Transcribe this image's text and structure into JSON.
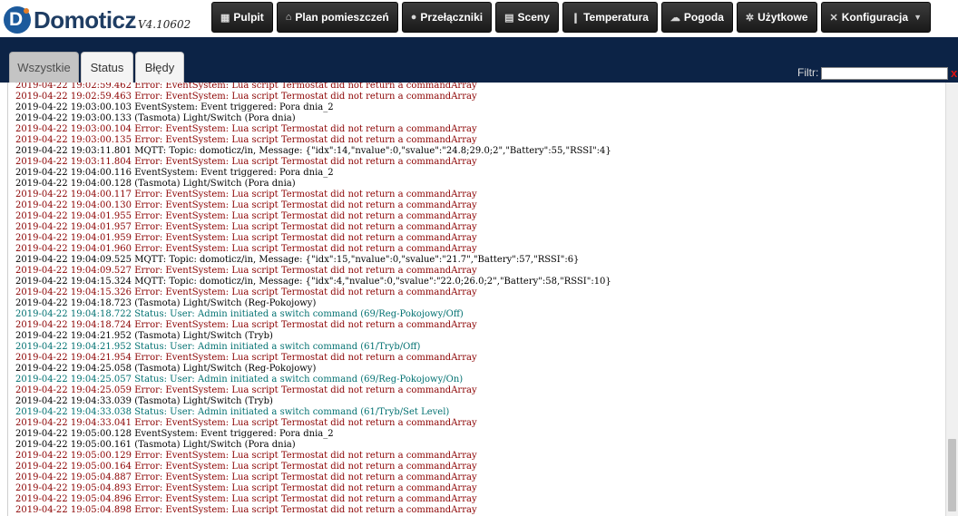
{
  "app": {
    "name": "Domoticz",
    "version": "V4.10602"
  },
  "nav": [
    {
      "label": "Pulpit",
      "icon": "dashboard-icon",
      "glyph": "▦",
      "caret": false
    },
    {
      "label": "Plan pomieszczeń",
      "icon": "floorplan-icon",
      "glyph": "⌂",
      "caret": false
    },
    {
      "label": "Przełączniki",
      "icon": "lightbulb-icon",
      "glyph": "●",
      "caret": false
    },
    {
      "label": "Sceny",
      "icon": "scenes-icon",
      "glyph": "▤",
      "caret": false
    },
    {
      "label": "Temperatura",
      "icon": "thermometer-icon",
      "glyph": "❙",
      "caret": false
    },
    {
      "label": "Pogoda",
      "icon": "weather-icon",
      "glyph": "☁",
      "caret": false
    },
    {
      "label": "Użytkowe",
      "icon": "utility-icon",
      "glyph": "✲",
      "caret": false
    },
    {
      "label": "Konfiguracja",
      "icon": "wrench-icon",
      "glyph": "✕",
      "caret": true
    }
  ],
  "tabs": [
    {
      "label": "Wszystkie",
      "active": true
    },
    {
      "label": "Status",
      "active": false
    },
    {
      "label": "Błędy",
      "active": false
    }
  ],
  "filter": {
    "label": "Filtr:",
    "value": "",
    "placeholder": "",
    "clear_glyph": "x"
  },
  "colors": {
    "topbar_bg": "#ffffff",
    "band_bg": "#0c2346",
    "error_text": "#8b0000",
    "status_text": "#007070",
    "normal_text": "#000000"
  },
  "log": [
    {
      "t": "2019-04-22 19:02:59.462",
      "type": "error",
      "msg": "Error: EventSystem: Lua script Termostat did not return a commandArray"
    },
    {
      "t": "2019-04-22 19:02:59.463",
      "type": "error",
      "msg": "Error: EventSystem: Lua script Termostat did not return a commandArray"
    },
    {
      "t": "2019-04-22 19:03:00.103",
      "type": "norm",
      "msg": "EventSystem: Event triggered: Pora dnia_2"
    },
    {
      "t": "2019-04-22 19:03:00.133",
      "type": "norm",
      "msg": "(Tasmota) Light/Switch (Pora dnia)"
    },
    {
      "t": "2019-04-22 19:03:00.104",
      "type": "error",
      "msg": "Error: EventSystem: Lua script Termostat did not return a commandArray"
    },
    {
      "t": "2019-04-22 19:03:00.135",
      "type": "error",
      "msg": "Error: EventSystem: Lua script Termostat did not return a commandArray"
    },
    {
      "t": "2019-04-22 19:03:11.801",
      "type": "norm",
      "msg": "MQTT: Topic: domoticz/in, Message: {\"idx\":14,\"nvalue\":0,\"svalue\":\"24.8;29.0;2\",\"Battery\":55,\"RSSI\":4}"
    },
    {
      "t": "2019-04-22 19:03:11.804",
      "type": "error",
      "msg": "Error: EventSystem: Lua script Termostat did not return a commandArray"
    },
    {
      "t": "2019-04-22 19:04:00.116",
      "type": "norm",
      "msg": "EventSystem: Event triggered: Pora dnia_2"
    },
    {
      "t": "2019-04-22 19:04:00.128",
      "type": "norm",
      "msg": "(Tasmota) Light/Switch (Pora dnia)"
    },
    {
      "t": "2019-04-22 19:04:00.117",
      "type": "error",
      "msg": "Error: EventSystem: Lua script Termostat did not return a commandArray"
    },
    {
      "t": "2019-04-22 19:04:00.130",
      "type": "error",
      "msg": "Error: EventSystem: Lua script Termostat did not return a commandArray"
    },
    {
      "t": "2019-04-22 19:04:01.955",
      "type": "error",
      "msg": "Error: EventSystem: Lua script Termostat did not return a commandArray"
    },
    {
      "t": "2019-04-22 19:04:01.957",
      "type": "error",
      "msg": "Error: EventSystem: Lua script Termostat did not return a commandArray"
    },
    {
      "t": "2019-04-22 19:04:01.959",
      "type": "error",
      "msg": "Error: EventSystem: Lua script Termostat did not return a commandArray"
    },
    {
      "t": "2019-04-22 19:04:01.960",
      "type": "error",
      "msg": "Error: EventSystem: Lua script Termostat did not return a commandArray"
    },
    {
      "t": "2019-04-22 19:04:09.525",
      "type": "norm",
      "msg": "MQTT: Topic: domoticz/in, Message: {\"idx\":15,\"nvalue\":0,\"svalue\":\"21.7\",\"Battery\":57,\"RSSI\":6}"
    },
    {
      "t": "2019-04-22 19:04:09.527",
      "type": "error",
      "msg": "Error: EventSystem: Lua script Termostat did not return a commandArray"
    },
    {
      "t": "2019-04-22 19:04:15.324",
      "type": "norm",
      "msg": "MQTT: Topic: domoticz/in, Message: {\"idx\":4,\"nvalue\":0,\"svalue\":\"22.0;26.0;2\",\"Battery\":58,\"RSSI\":10}"
    },
    {
      "t": "2019-04-22 19:04:15.326",
      "type": "error",
      "msg": "Error: EventSystem: Lua script Termostat did not return a commandArray"
    },
    {
      "t": "2019-04-22 19:04:18.723",
      "type": "norm",
      "msg": "(Tasmota) Light/Switch (Reg-Pokojowy)"
    },
    {
      "t": "2019-04-22 19:04:18.722",
      "type": "status",
      "msg": "Status: User: Admin initiated a switch command (69/Reg-Pokojowy/Off)"
    },
    {
      "t": "2019-04-22 19:04:18.724",
      "type": "error",
      "msg": "Error: EventSystem: Lua script Termostat did not return a commandArray"
    },
    {
      "t": "2019-04-22 19:04:21.952",
      "type": "norm",
      "msg": "(Tasmota) Light/Switch (Tryb)"
    },
    {
      "t": "2019-04-22 19:04:21.952",
      "type": "status",
      "msg": "Status: User: Admin initiated a switch command (61/Tryb/Off)"
    },
    {
      "t": "2019-04-22 19:04:21.954",
      "type": "error",
      "msg": "Error: EventSystem: Lua script Termostat did not return a commandArray"
    },
    {
      "t": "2019-04-22 19:04:25.058",
      "type": "norm",
      "msg": "(Tasmota) Light/Switch (Reg-Pokojowy)"
    },
    {
      "t": "2019-04-22 19:04:25.057",
      "type": "status",
      "msg": "Status: User: Admin initiated a switch command (69/Reg-Pokojowy/On)"
    },
    {
      "t": "2019-04-22 19:04:25.059",
      "type": "error",
      "msg": "Error: EventSystem: Lua script Termostat did not return a commandArray"
    },
    {
      "t": "2019-04-22 19:04:33.039",
      "type": "norm",
      "msg": "(Tasmota) Light/Switch (Tryb)"
    },
    {
      "t": "2019-04-22 19:04:33.038",
      "type": "status",
      "msg": "Status: User: Admin initiated a switch command (61/Tryb/Set Level)"
    },
    {
      "t": "2019-04-22 19:04:33.041",
      "type": "error",
      "msg": "Error: EventSystem: Lua script Termostat did not return a commandArray"
    },
    {
      "t": "2019-04-22 19:05:00.128",
      "type": "norm",
      "msg": "EventSystem: Event triggered: Pora dnia_2"
    },
    {
      "t": "2019-04-22 19:05:00.161",
      "type": "norm",
      "msg": "(Tasmota) Light/Switch (Pora dnia)"
    },
    {
      "t": "2019-04-22 19:05:00.129",
      "type": "error",
      "msg": "Error: EventSystem: Lua script Termostat did not return a commandArray"
    },
    {
      "t": "2019-04-22 19:05:00.164",
      "type": "error",
      "msg": "Error: EventSystem: Lua script Termostat did not return a commandArray"
    },
    {
      "t": "2019-04-22 19:05:04.887",
      "type": "error",
      "msg": "Error: EventSystem: Lua script Termostat did not return a commandArray"
    },
    {
      "t": "2019-04-22 19:05:04.893",
      "type": "error",
      "msg": "Error: EventSystem: Lua script Termostat did not return a commandArray"
    },
    {
      "t": "2019-04-22 19:05:04.896",
      "type": "error",
      "msg": "Error: EventSystem: Lua script Termostat did not return a commandArray"
    },
    {
      "t": "2019-04-22 19:05:04.898",
      "type": "error",
      "msg": "Error: EventSystem: Lua script Termostat did not return a commandArray"
    }
  ]
}
